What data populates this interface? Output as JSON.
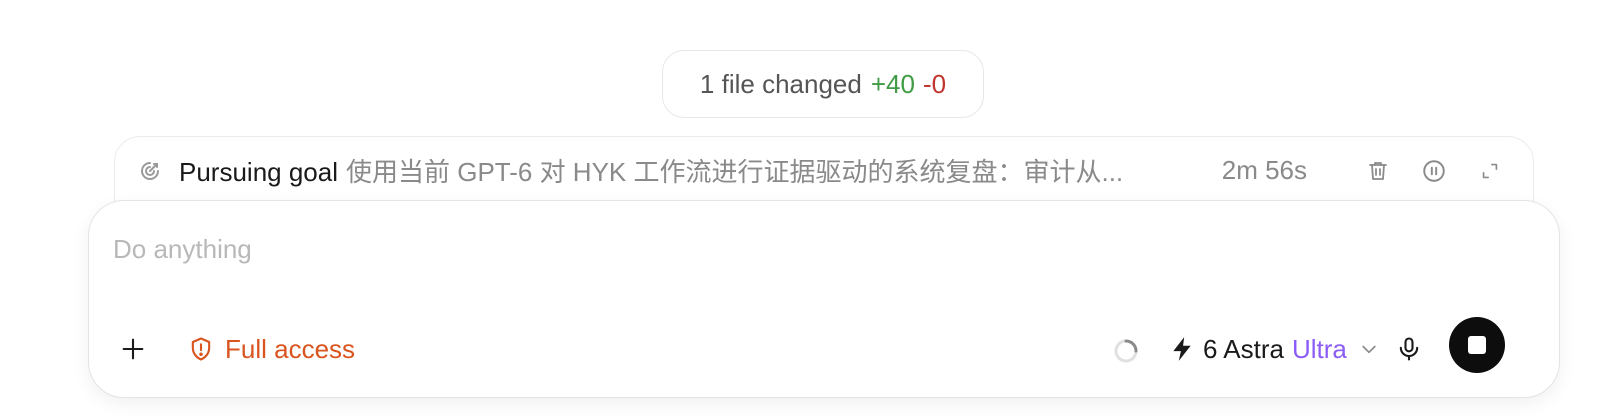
{
  "files_summary": {
    "text": "1 file changed",
    "additions": "+40",
    "deletions": "-0",
    "additions_color": "#3f9b45",
    "deletions_color": "#c0362c"
  },
  "goal": {
    "icon": "goal-target-icon",
    "lead": "Pursuing goal",
    "text": "使用当前 GPT-6 对 HYK 工作流进行证据驱动的系统复盘：审计从...",
    "elapsed": "2m 56s",
    "actions": [
      "trash-icon",
      "pause-icon",
      "expand-icon"
    ]
  },
  "composer": {
    "placeholder": "Do anything",
    "value": "",
    "add_icon": "plus-icon",
    "access_label": "Full access",
    "access_icon": "shield-alert-icon",
    "access_color": "#d9541e",
    "status_icon": "loading-spinner-icon",
    "model": {
      "icon": "bolt-icon",
      "name": "6 Astra",
      "tier": "Ultra",
      "tier_color": "#8b5cf6",
      "dropdown_icon": "chevron-down-icon"
    },
    "mic_icon": "microphone-icon",
    "stop_icon": "stop-icon"
  }
}
